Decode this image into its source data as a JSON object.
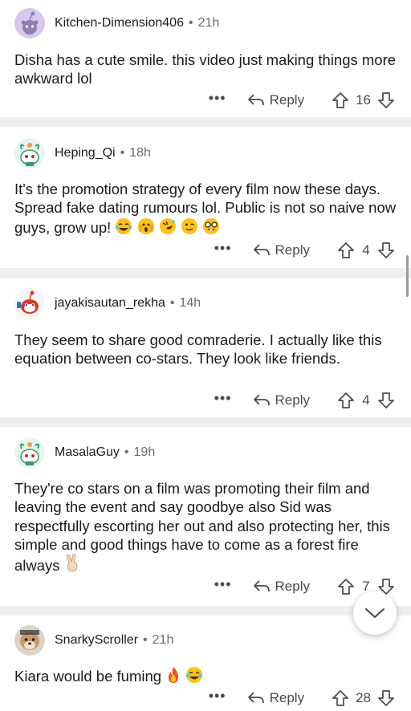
{
  "comments": [
    {
      "username": "Kitchen-Dimension406",
      "time": "21h",
      "text": "Disha has a cute smile. this video just making things more awkward lol",
      "reply_label": "Reply",
      "votes": "16",
      "avatar_icon": "default-snoo-avatar"
    },
    {
      "username": "Heping_Qi",
      "time": "18h",
      "text": "It's the promotion strategy of every film now these days. Spread fake dating rumours lol. Public is not so naive now guys, grow up!",
      "emojis": [
        "face-with-tears-of-joy-icon",
        "face-screaming-icon",
        "rolling-on-floor-laughing-icon",
        "winking-face-icon",
        "nerd-face-icon"
      ],
      "reply_label": "Reply",
      "votes": "4",
      "avatar_icon": "snoo-festive-avatar"
    },
    {
      "username": "jayakisautan_rekha",
      "time": "14h",
      "text": "They seem to share good comraderie. I actually like this equation between co-stars. They look like friends.",
      "reply_label": "Reply",
      "votes": "4",
      "avatar_icon": "snoo-red-avatar"
    },
    {
      "username": "MasalaGuy",
      "time": "19h",
      "text": "They're co stars on a film was promoting their film and leaving the event and say goodbye also Sid was respectfully escorting her out and also protecting her, this simple and good things have to come as a forest fire always",
      "emojis": [
        "victory-hand-icon"
      ],
      "reply_label": "Reply",
      "votes": "7",
      "avatar_icon": "snoo-festive-avatar"
    },
    {
      "username": "SnarkyScroller",
      "time": "21h",
      "text": "Kiara would be fuming",
      "emojis": [
        "fire-icon",
        "face-with-tears-of-joy-icon"
      ],
      "reply_label": "Reply",
      "votes": "28",
      "avatar_icon": "dog-photo-avatar"
    }
  ],
  "more_label": "•••",
  "jump_button_icon": "chevron-down-icon",
  "colors": {
    "separator": "#edeff1",
    "meta_text": "#6b6b6b",
    "body_text": "#1a1a1b"
  }
}
